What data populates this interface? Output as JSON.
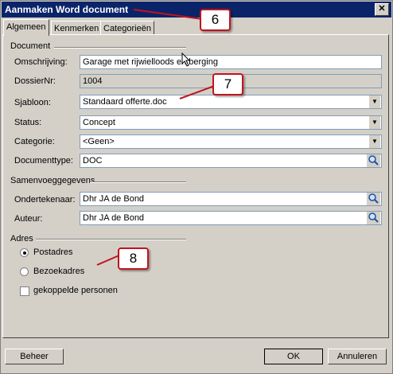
{
  "window": {
    "title": "Aanmaken Word document",
    "close_glyph": "✕"
  },
  "tabs": [
    "Algemeen",
    "Kenmerken",
    "Categorieën"
  ],
  "sections": {
    "document": "Document",
    "samenvoeg": "Samenvoeggegevens",
    "adres": "Adres"
  },
  "fields": {
    "omschrijving": {
      "label": "Omschrijving:",
      "value": "Garage met rijwielloods en berging"
    },
    "dossiernr": {
      "label": "DossierNr:",
      "value": "1004"
    },
    "sjabloon": {
      "label": "Sjabloon:",
      "value": "Standaard offerte.doc"
    },
    "status": {
      "label": "Status:",
      "value": "Concept"
    },
    "categorie": {
      "label": "Categorie:",
      "value": "<Geen>"
    },
    "documenttype": {
      "label": "Documenttype:",
      "value": "DOC"
    },
    "ondertekenaar": {
      "label": "Ondertekenaar:",
      "value": "Dhr JA de Bond"
    },
    "auteur": {
      "label": "Auteur:",
      "value": "Dhr JA de Bond"
    }
  },
  "adres": {
    "postadres": "Postadres",
    "bezoekadres": "Bezoekadres",
    "gekoppelde": "gekoppelde personen",
    "selected": "postadres"
  },
  "buttons": {
    "beheer": "Beheer",
    "ok": "OK",
    "annuleren": "Annuleren"
  },
  "callouts": {
    "c6": "6",
    "c7": "7",
    "c8": "8"
  },
  "colors": {
    "titlebar": "#0a246a",
    "callout_border": "#c0141d",
    "dialog_bg": "#d4d0c8"
  },
  "icons": {
    "dropdown": "dropdown-arrow-icon",
    "lookup": "magnifier-icon"
  }
}
